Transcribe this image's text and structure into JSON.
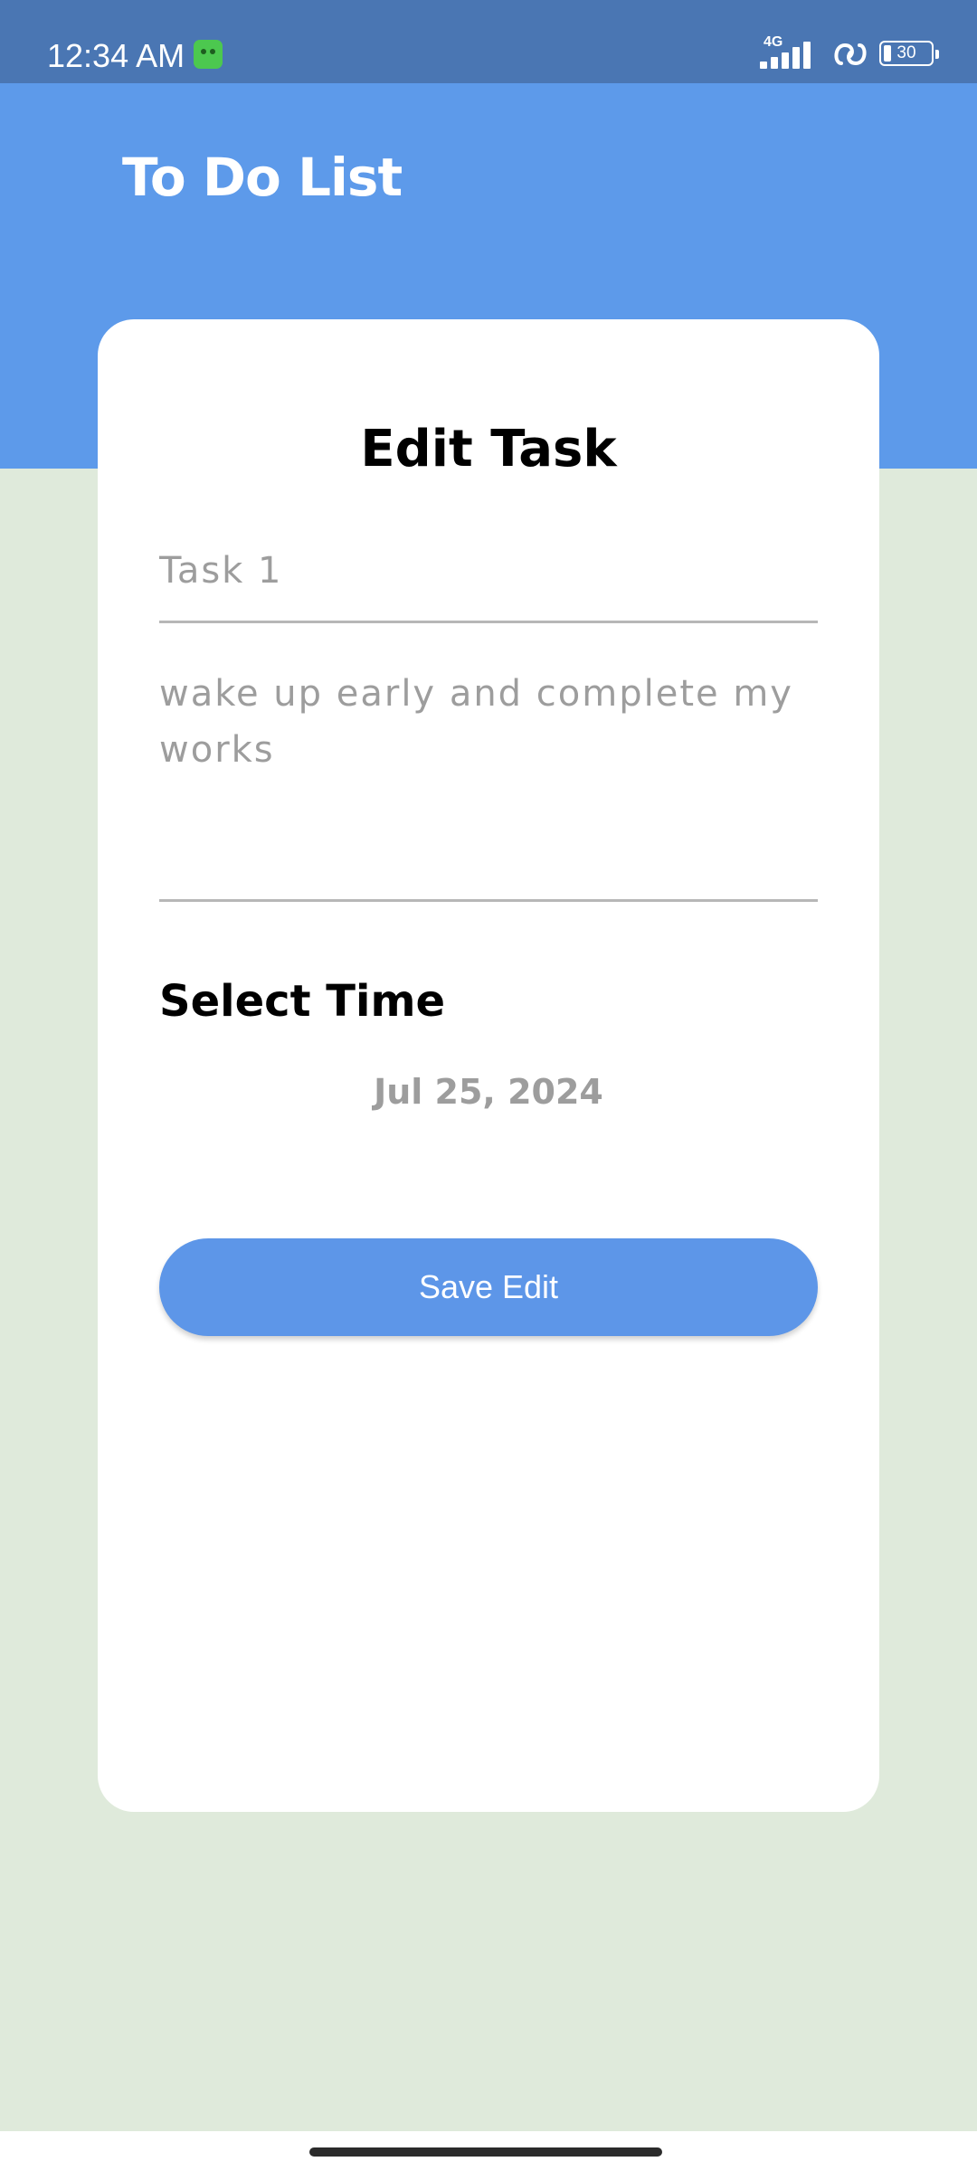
{
  "status_bar": {
    "time": "12:34 AM",
    "network": "4G",
    "battery_level": "30",
    "icons": [
      "app-notification-icon",
      "signal-icon",
      "hotspot-icon",
      "battery-icon"
    ]
  },
  "header": {
    "title": "To Do List"
  },
  "edit_task": {
    "title": "Edit Task",
    "task_title_value": "Task 1",
    "task_description_value": "wake up early and complete my works",
    "select_time_label": "Select Time",
    "selected_date": "Jul 25, 2024",
    "save_button_label": "Save Edit"
  },
  "colors": {
    "status_bar": "#4a76b3",
    "header": "#5d9aea",
    "background": "#dfeadb",
    "card": "#ffffff",
    "button": "#5d96e8",
    "muted_text": "#9d9d9d"
  }
}
